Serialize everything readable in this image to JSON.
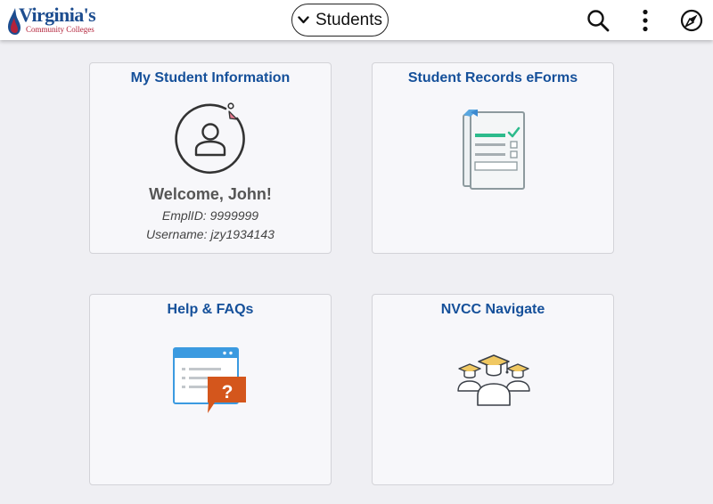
{
  "header": {
    "logo": {
      "name": "Virginia's",
      "subtitle": "Community Colleges"
    },
    "home_selector": {
      "label": "Students"
    },
    "icons": [
      "search-icon",
      "more-options-icon",
      "navigator-compass-icon"
    ]
  },
  "tiles": [
    {
      "title": "My Student Information",
      "icon": "user-avatar-icon",
      "welcome": "Welcome, John!",
      "emplid": "EmplID: 9999999",
      "username": "Username: jzy1934143"
    },
    {
      "title": "Student Records eForms",
      "icon": "eforms-document-icon"
    },
    {
      "title": "Help & FAQs",
      "icon": "help-faq-window-icon",
      "icon_badge": "?"
    },
    {
      "title": "NVCC Navigate",
      "icon": "graduates-group-icon"
    }
  ],
  "colors": {
    "tile_title": "#15509a",
    "accent_green": "#2dbb8c",
    "help_orange": "#d4561c",
    "help_blue": "#3b9ae0",
    "grad_cap_gold": "#f0c862"
  }
}
